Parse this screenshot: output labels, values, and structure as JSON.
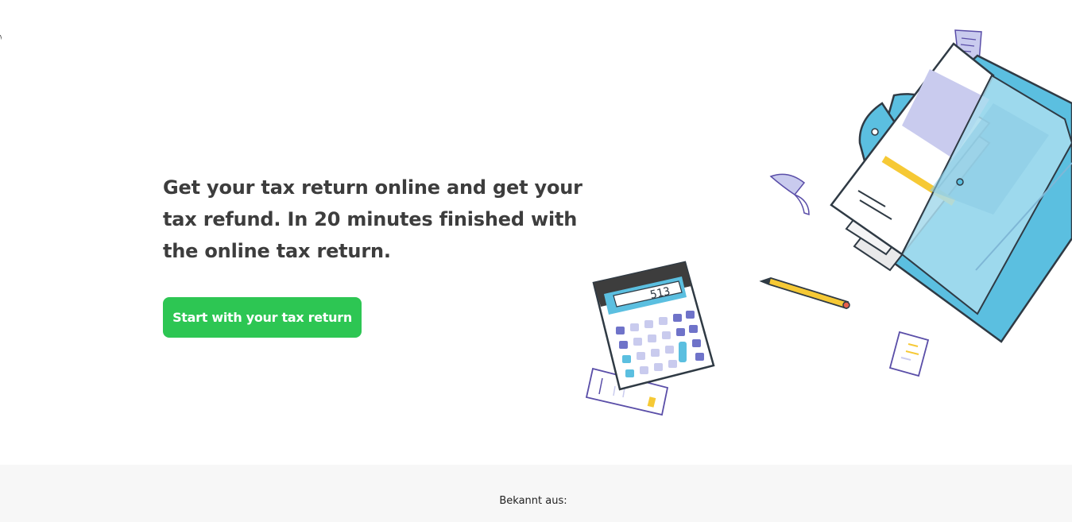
{
  "hero": {
    "headline": "Get your tax return online and get your tax refund. In 20 minutes finished with the online tax return.",
    "cta_label": "Start with your tax return",
    "cta_color": "#2dc653"
  },
  "illustration": {
    "calculator_display": "513",
    "icons": [
      "calculator-icon",
      "folder-icon",
      "documents-icon",
      "pencil-icon",
      "receipt-icon",
      "paper-scrap-icon"
    ]
  },
  "press": {
    "label": "Bekannt aus:"
  },
  "colors": {
    "text": "#3d3d3d",
    "accent_green": "#2dc653",
    "folder_blue": "#5bbfe0",
    "lavender": "#c9cbee",
    "violet": "#5a4ea8",
    "yellow": "#f6c935",
    "footer_bg": "#f7f7f7"
  }
}
